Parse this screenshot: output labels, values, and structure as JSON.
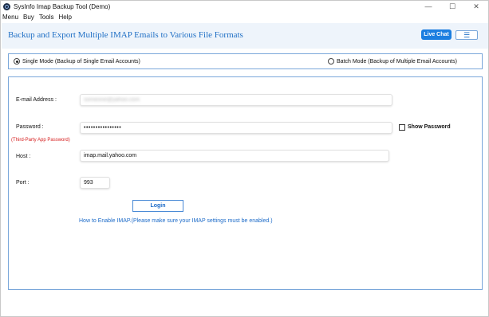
{
  "window": {
    "title": "SysInfo Imap Backup Tool (Demo)",
    "minimize": "—",
    "maximize": "☐",
    "close": "✕"
  },
  "menu": [
    "Menu",
    "Buy",
    "Tools",
    "Help"
  ],
  "header": {
    "title": "Backup and Export Multiple IMAP Emails to Various File Formats",
    "live_chat": "Live Chat",
    "hamburger": "☰"
  },
  "mode": {
    "single": "Single Mode (Backup of Single Email Accounts)",
    "batch": "Batch Mode (Backup of Multiple Email Accounts)",
    "selected": "single"
  },
  "form": {
    "email_label": "E-mail Address :",
    "email_value": "someone@yahoo.com",
    "password_label": "Password :",
    "password_value": "••••••••••••••••",
    "password_hint": "(Third-Party App Password)",
    "show_password": "Show Password",
    "host_label": "Host :",
    "host_value": "imap.mail.yahoo.com",
    "port_label": "Port :",
    "port_value": "993",
    "login": "Login",
    "imap_help": "How to Enable IMAP.(Please make sure your IMAP settings must be enabled.)"
  },
  "colors": {
    "accent": "#1f6fc5",
    "live_chat_bg": "#1b7ee0",
    "border": "#7aa7da",
    "hint": "#d62020"
  }
}
